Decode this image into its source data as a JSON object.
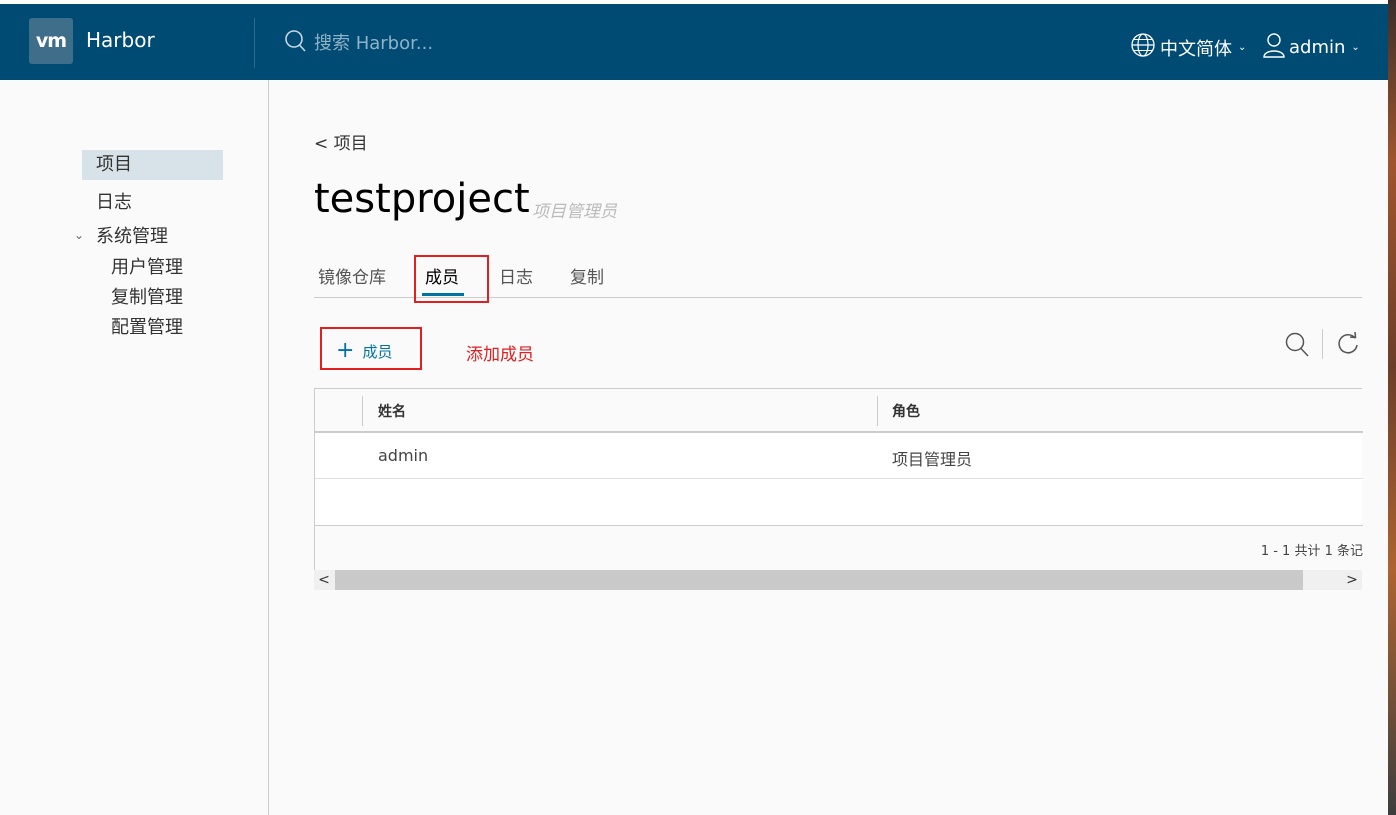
{
  "header": {
    "logo": "vm",
    "app_name": "Harbor",
    "search_placeholder": "搜索 Harbor...",
    "language": "中文简体",
    "user": "admin",
    "colors": {
      "bar": "#004b74",
      "accent": "#0072a3"
    }
  },
  "sidebar": {
    "items": [
      {
        "label": "项目",
        "active": true
      },
      {
        "label": "日志"
      },
      {
        "label": "系统管理",
        "expanded": true
      }
    ],
    "sub_items": [
      {
        "label": "用户管理"
      },
      {
        "label": "复制管理"
      },
      {
        "label": "配置管理"
      }
    ]
  },
  "main": {
    "breadcrumb": "< 项目",
    "project_name": "testproject",
    "project_role": "项目管理员",
    "tabs": [
      {
        "label": "镜像仓库"
      },
      {
        "label": "成员",
        "active": true
      },
      {
        "label": "日志"
      },
      {
        "label": "复制"
      }
    ],
    "add_member_label": "成员",
    "annotation": "添加成员",
    "table": {
      "columns": [
        "姓名",
        "角色"
      ],
      "rows": [
        {
          "name": "admin",
          "role": "项目管理员"
        }
      ],
      "footer": "1 - 1 共计 1 条记"
    },
    "scrollbar": {
      "left_arrow": "<",
      "right_arrow": ">"
    }
  }
}
